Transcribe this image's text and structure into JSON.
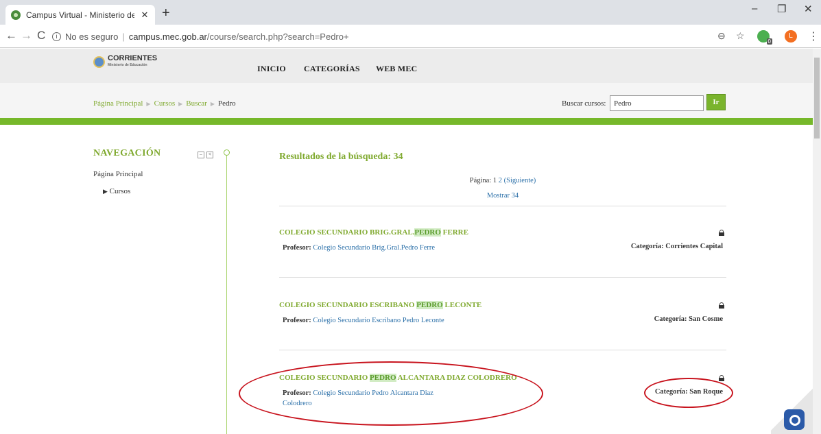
{
  "browser": {
    "tab_title": "Campus Virtual - Ministerio de E",
    "tab_close": "✕",
    "new_tab": "+",
    "win_minimize": "–",
    "win_restore": "❐",
    "win_close": "✕",
    "back": "←",
    "forward": "→",
    "reload": "C",
    "not_secure": "No es seguro",
    "url_host": "campus.mec.gob.ar",
    "url_path": "/course/search.php?search=Pedro+",
    "zoom_icon": "⊖",
    "star_icon": "☆",
    "extension_badge": "0",
    "avatar_letter": "L",
    "menu": "⋮"
  },
  "header": {
    "logo_name": "CORRIENTES",
    "logo_sub": "Ministerio de Educación",
    "nav": [
      "INICIO",
      "CATEGORÍAS",
      "WEB MEC"
    ]
  },
  "breadcrumb": {
    "items": [
      "Página Principal",
      "Cursos",
      "Buscar"
    ],
    "current": "Pedro"
  },
  "search": {
    "label": "Buscar cursos:",
    "value": "Pedro",
    "button": "Ir"
  },
  "sidebar": {
    "title": "NAVEGACIÓN",
    "ctl_collapse": "–",
    "ctl_dock": "<",
    "home": "Página Principal",
    "courses": "Cursos"
  },
  "results": {
    "title": "Resultados de la búsqueda: 34",
    "page_label": "Página:",
    "page_current": "1",
    "page_next_num": "2",
    "page_next": "(Siguiente)",
    "show_all": "Mostrar 34",
    "courses": [
      {
        "name_pre": "COLEGIO SECUNDARIO BRIG.GRAL.",
        "name_hl": "PEDRO",
        "name_post": " FERRE",
        "prof_label": "Profesor:",
        "prof": "Colegio Secundario Brig.Gral.Pedro Ferre",
        "category": "Categoría: Corrientes Capital"
      },
      {
        "name_pre": "COLEGIO SECUNDARIO ESCRIBANO ",
        "name_hl": "PEDRO",
        "name_post": " LECONTE",
        "prof_label": "Profesor:",
        "prof": "Colegio Secundario Escribano Pedro Leconte",
        "category": "Categoría: San Cosme"
      },
      {
        "name_pre": "COLEGIO SECUNDARIO ",
        "name_hl": "PEDRO",
        "name_post": " ALCANTARA DIAZ COLODRERO",
        "prof_label": "Profesor:",
        "prof": "Colegio Secundario Pedro Alcantara Diaz Colodrero",
        "category": "Categoría: San Roque"
      }
    ]
  },
  "colors": {
    "brand_green": "#7fa92e",
    "bar_green": "#76b82a",
    "link_blue": "#2a6fa8",
    "annotation_red": "#c8141e"
  }
}
